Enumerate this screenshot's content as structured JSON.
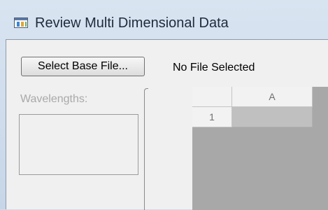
{
  "window": {
    "title": "Review Multi Dimensional Data",
    "icon": "data-window-icon"
  },
  "controls": {
    "select_button_label": "Select Base File...",
    "file_status": "No File Selected",
    "wavelengths_label": "Wavelengths:"
  },
  "grid": {
    "columns": [
      "A"
    ],
    "rows": [
      "1"
    ]
  },
  "colors": {
    "client_background": "#f0f0f0",
    "grid_background": "#a8a8a8",
    "disabled_text": "#a9a9a9"
  }
}
